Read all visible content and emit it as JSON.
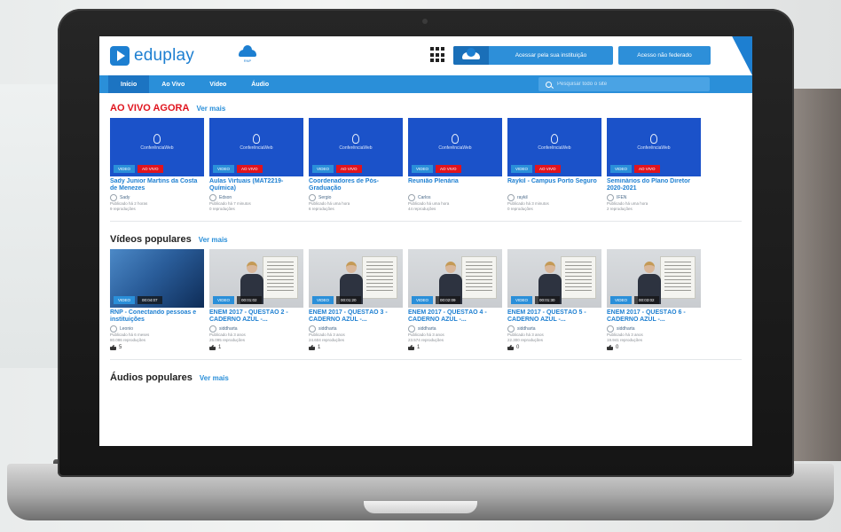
{
  "brand": {
    "logo_text": "eduplay",
    "partner_caption": "RNP"
  },
  "header": {
    "institution_button": "Acessar pela sua instituição",
    "federated_button": "Acesso não federado"
  },
  "nav": {
    "items": [
      "Início",
      "Ao Vivo",
      "Vídeo",
      "Áudio"
    ],
    "search_placeholder": "Pesquisar todo o site"
  },
  "live": {
    "title": "AO VIVO AGORA",
    "see_more": "Ver mais",
    "thumb_caption": "ConferênciaWeb",
    "tag_video": "VIDEO",
    "tag_live": "AO VIVO",
    "cards": [
      {
        "title": "Sady Junior Martins da Costa de Menezes",
        "author": "Sady",
        "published": "Publicado há 2 horas",
        "plays": "9 reproduções"
      },
      {
        "title": "Aulas Virtuais (MAT2219-Química)",
        "author": "Edson",
        "published": "Publicado há 7 minutos",
        "plays": "0 reproduções"
      },
      {
        "title": "Coordenadores de Pós-Graduação",
        "author": "Sergio",
        "published": "Publicado há uma hora",
        "plays": "6 reproduções"
      },
      {
        "title": "Reunião Plenária",
        "author": "Carlos",
        "published": "Publicado há uma hora",
        "plays": "44 reproduções"
      },
      {
        "title": "Raykil - Campus Porto Seguro",
        "author": "raykil",
        "published": "Publicado há 3 minutos",
        "plays": "0 reproduções"
      },
      {
        "title": "Seminários do Plano Diretor 2020-2021",
        "author": "IFEN",
        "published": "Publicado há uma hora",
        "plays": "2 reproduções"
      }
    ]
  },
  "popular": {
    "title": "Vídeos populares",
    "see_more": "Ver mais",
    "tag_video": "VIDEO",
    "cards": [
      {
        "title": "RNP - Conectando pessoas e instituições",
        "duration": "00:04:07",
        "author": "Leonio",
        "published": "Publicado há 6 meses",
        "plays": "80.086 reproduções",
        "likes": "5"
      },
      {
        "title": "ENEM 2017 - QUESTÃO 2 - CADERNO AZUL -...",
        "duration": "00:01:02",
        "author": "siddharta",
        "published": "Publicado há 3 anos",
        "plays": "25.095 reproduções",
        "likes": "1"
      },
      {
        "title": "ENEM 2017 - QUESTÃO 3 - CADERNO AZUL -...",
        "duration": "00:01:20",
        "author": "siddharta",
        "published": "Publicado há 3 anos",
        "plays": "24.604 reproduções",
        "likes": "1"
      },
      {
        "title": "ENEM 2017 - QUESTÃO 4 - CADERNO AZUL -...",
        "duration": "00:02:09",
        "author": "siddharta",
        "published": "Publicado há 3 anos",
        "plays": "23.574 reproduções",
        "likes": "1"
      },
      {
        "title": "ENEM 2017 - QUESTÃO 5 - CADERNO AZUL -...",
        "duration": "00:01:30",
        "author": "siddharta",
        "published": "Publicado há 3 anos",
        "plays": "22.300 reproduções",
        "likes": "0"
      },
      {
        "title": "ENEM 2017 - QUESTÃO 6 - CADERNO AZUL -...",
        "duration": "00:03:02",
        "author": "siddharta",
        "published": "Publicado há 3 anos",
        "plays": "19.941 reproduções",
        "likes": "0"
      }
    ]
  },
  "audio": {
    "title": "Áudios populares",
    "see_more": "Ver mais"
  }
}
